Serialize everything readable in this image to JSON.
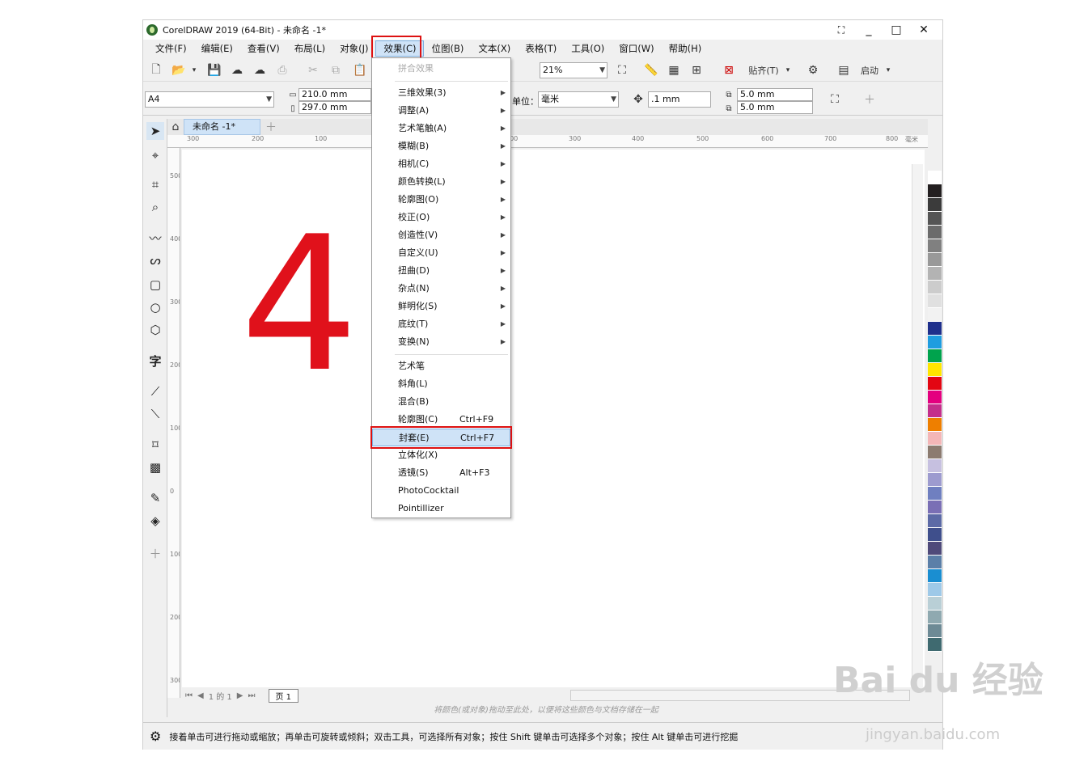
{
  "window": {
    "title": "CorelDRAW 2019 (64-Bit) - 未命名 -1*",
    "controls": [
      "_",
      "□",
      "✕"
    ]
  },
  "menubar": [
    "文件(F)",
    "编辑(E)",
    "查看(V)",
    "布局(L)",
    "对象(J)",
    "效果(C)",
    "位图(B)",
    "文本(X)",
    "表格(T)",
    "工具(O)",
    "窗口(W)",
    "帮助(H)"
  ],
  "menubar_active": "效果(C)",
  "toolbar1": {
    "zoom": "21%",
    "snap_label": "贴齐(T)",
    "launch_label": "启动"
  },
  "toolbar2": {
    "page_size": "A4",
    "width": "210.0 mm",
    "height": "297.0 mm",
    "units_label": "单位：",
    "units": "毫米",
    "nudge": ".1 mm",
    "dup_x": "5.0 mm",
    "dup_y": "5.0 mm"
  },
  "doc_tab": "未命名 -1*",
  "ruler_h": [
    "300",
    "200",
    "100",
    "0",
    "100",
    "200",
    "300",
    "400",
    "500",
    "600",
    "700",
    "800"
  ],
  "ruler_h_unit": "毫米",
  "ruler_v": [
    "500",
    "400",
    "300",
    "200",
    "100",
    "0",
    "100",
    "200",
    "300"
  ],
  "canvas": {
    "big_text": "4"
  },
  "effects_menu": [
    {
      "label": "拼合效果",
      "disabled": true
    },
    {
      "sep": true
    },
    {
      "label": "三维效果(3)",
      "sub": true
    },
    {
      "label": "调整(A)",
      "sub": true
    },
    {
      "label": "艺术笔触(A)",
      "sub": true
    },
    {
      "label": "模糊(B)",
      "sub": true
    },
    {
      "label": "相机(C)",
      "sub": true
    },
    {
      "label": "颜色转换(L)",
      "sub": true
    },
    {
      "label": "轮廓图(O)",
      "sub": true
    },
    {
      "label": "校正(O)",
      "sub": true
    },
    {
      "label": "创造性(V)",
      "sub": true
    },
    {
      "label": "自定义(U)",
      "sub": true
    },
    {
      "label": "扭曲(D)",
      "sub": true
    },
    {
      "label": "杂点(N)",
      "sub": true
    },
    {
      "label": "鲜明化(S)",
      "sub": true
    },
    {
      "label": "底纹(T)",
      "sub": true
    },
    {
      "label": "变换(N)",
      "sub": true
    },
    {
      "sep": true
    },
    {
      "label": "艺术笔"
    },
    {
      "label": "斜角(L)"
    },
    {
      "label": "混合(B)"
    },
    {
      "label": "轮廓图(C)",
      "shortcut": "Ctrl+F9"
    },
    {
      "label": "封套(E)",
      "shortcut": "Ctrl+F7",
      "selected": true
    },
    {
      "label": "立体化(X)"
    },
    {
      "label": "透镜(S)",
      "shortcut": "Alt+F3"
    },
    {
      "label": "PhotoCocktail"
    },
    {
      "label": "Pointillizer"
    }
  ],
  "page_nav": {
    "counter": "1 的 1",
    "page_tab": "页 1"
  },
  "palette_hint": "将颜色(或对象)拖动至此处，以便将这些颜色与文档存储在一起",
  "status_text": "接着单击可进行拖动或缩放；再单击可旋转或倾斜；双击工具，可选择所有对象；按住 Shift 键单击可选择多个对象；按住 Alt 键单击可进行挖掘",
  "watermark": {
    "main": "Bai du 经验",
    "sub": "jingyan.baidu.com"
  },
  "palette_colors": [
    "#ffffff",
    "#231f20",
    "#3b3b3b",
    "#555555",
    "#6b6b6b",
    "#808080",
    "#999999",
    "#b3b3b3",
    "#cccccc",
    "#e0e0e0",
    "#f2f2f2",
    "#1e2f8c",
    "#1f9de0",
    "#00a34d",
    "#ffe600",
    "#e30613",
    "#e4007f",
    "#c42f8b",
    "#ee7f00",
    "#f4b6b7",
    "#8c7b70",
    "#c6c0e0",
    "#9d9bcf",
    "#6f7fc0",
    "#7a6fb5",
    "#5c6aa6",
    "#3f4f8c",
    "#4f4a7a",
    "#5b7fa8",
    "#1a8ed1",
    "#9ec9e8",
    "#b9cfd6",
    "#8fa9b0",
    "#6d8a95",
    "#3f6a70"
  ],
  "accent": "#d11111"
}
